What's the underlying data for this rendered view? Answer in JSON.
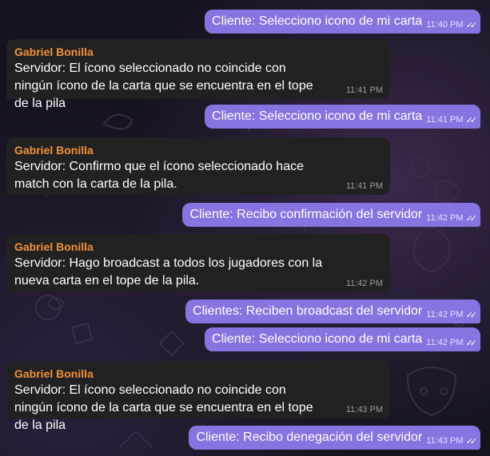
{
  "chat": {
    "messages": [
      {
        "direction": "out",
        "text": "Cliente: Selecciono icono de mi carta",
        "time": "11:40 PM"
      },
      {
        "direction": "in",
        "sender": "Gabriel Bonilla",
        "text": "Servidor: El ícono seleccionado no coincide con ningún ícono de la carta que se encuentra en el tope de la pila",
        "time": "11:41 PM"
      },
      {
        "direction": "out",
        "text": "Cliente: Selecciono icono de mi carta",
        "time": "11:41 PM"
      },
      {
        "direction": "in",
        "sender": "Gabriel Bonilla",
        "text": "Servidor: Confirmo que el ícono seleccionado hace match con la carta de la pila.",
        "time": "11:41 PM"
      },
      {
        "direction": "out",
        "text": "Cliente: Recibo confirmación del servidor",
        "time": "11:42 PM"
      },
      {
        "direction": "in",
        "sender": "Gabriel Bonilla",
        "text": "Servidor: Hago broadcast a todos los jugadores con la nueva carta en el tope de la pila.",
        "time": "11:42 PM"
      },
      {
        "direction": "out",
        "text": "Clientes: Reciben broadcast del servidor",
        "time": "11:42 PM"
      },
      {
        "direction": "out",
        "text": "Cliente: Selecciono icono de mi carta",
        "time": "11:42 PM"
      },
      {
        "direction": "in",
        "sender": "Gabriel Bonilla",
        "text": "Servidor: El ícono seleccionado no coincide con ningún ícono de la carta que se encuentra en el tope de la pila",
        "time": "11:43 PM"
      },
      {
        "direction": "out",
        "text": "Cliente: Recibo denegación del servidor",
        "time": "11:43 PM"
      }
    ],
    "read_icon": "double-check-icon",
    "colors": {
      "outgoing": "#8774e1",
      "incoming": "#212121",
      "sender": "#f1913a"
    }
  }
}
